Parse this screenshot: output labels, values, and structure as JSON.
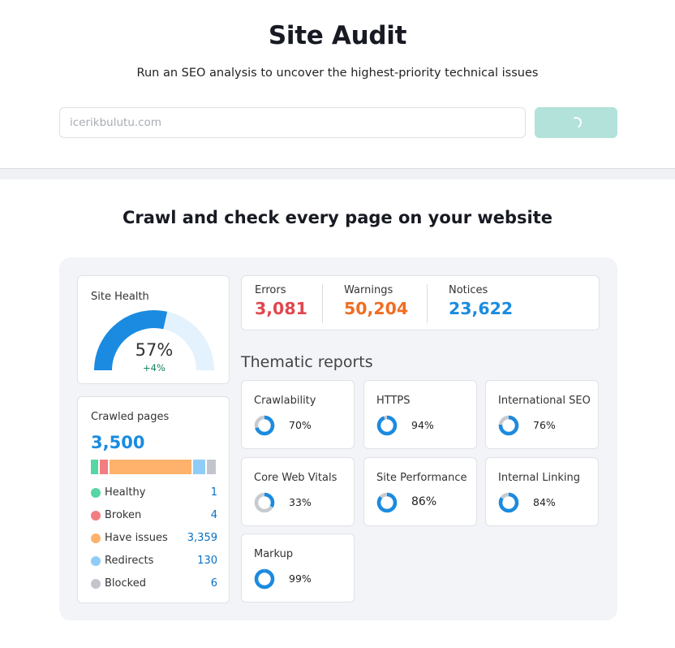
{
  "header": {
    "title": "Site Audit",
    "subtitle": "Run an SEO analysis to uncover the highest-priority technical issues",
    "input_placeholder": "icerikbulutu.com"
  },
  "section": {
    "title": "Crawl and check every page on your website"
  },
  "site_health": {
    "label": "Site Health",
    "percent": "57%",
    "percent_value": 57,
    "delta": "+4%"
  },
  "crawled_pages": {
    "label": "Crawled pages",
    "total": "3,500",
    "categories": [
      {
        "label": "Healthy",
        "value": "1",
        "color": "#56d6a5"
      },
      {
        "label": "Broken",
        "value": "4",
        "color": "#f27d82"
      },
      {
        "label": "Have issues",
        "value": "3,359",
        "color": "#ffb26b"
      },
      {
        "label": "Redirects",
        "value": "130",
        "color": "#8fcdf8"
      },
      {
        "label": "Blocked",
        "value": "6",
        "color": "#c2c6cc"
      }
    ]
  },
  "stats": {
    "errors": {
      "label": "Errors",
      "value": "3,081",
      "color": "#e0474e"
    },
    "warnings": {
      "label": "Warnings",
      "value": "50,204",
      "color": "#f06d22"
    },
    "notices": {
      "label": "Notices",
      "value": "23,622",
      "color": "#1a8be0"
    }
  },
  "thematic": {
    "title": "Thematic reports",
    "reports": [
      {
        "label": "Crawlability",
        "percent": "70%",
        "value": 70
      },
      {
        "label": "HTTPS",
        "percent": "94%",
        "value": 94
      },
      {
        "label": "International SEO",
        "percent": "76%",
        "value": 76
      },
      {
        "label": "Core Web Vitals",
        "percent": "33%",
        "value": 33
      },
      {
        "label": "Site Performance",
        "percent": "86%",
        "value": 86
      },
      {
        "label": "Internal Linking",
        "percent": "84%",
        "value": 84
      },
      {
        "label": "Markup",
        "percent": "99%",
        "value": 99
      }
    ]
  },
  "colors": {
    "accent": "#1a8be0",
    "donut_track": "#c7cbd1",
    "gauge_track": "#e3f2fc",
    "button_disabled": "#b2e2da"
  }
}
